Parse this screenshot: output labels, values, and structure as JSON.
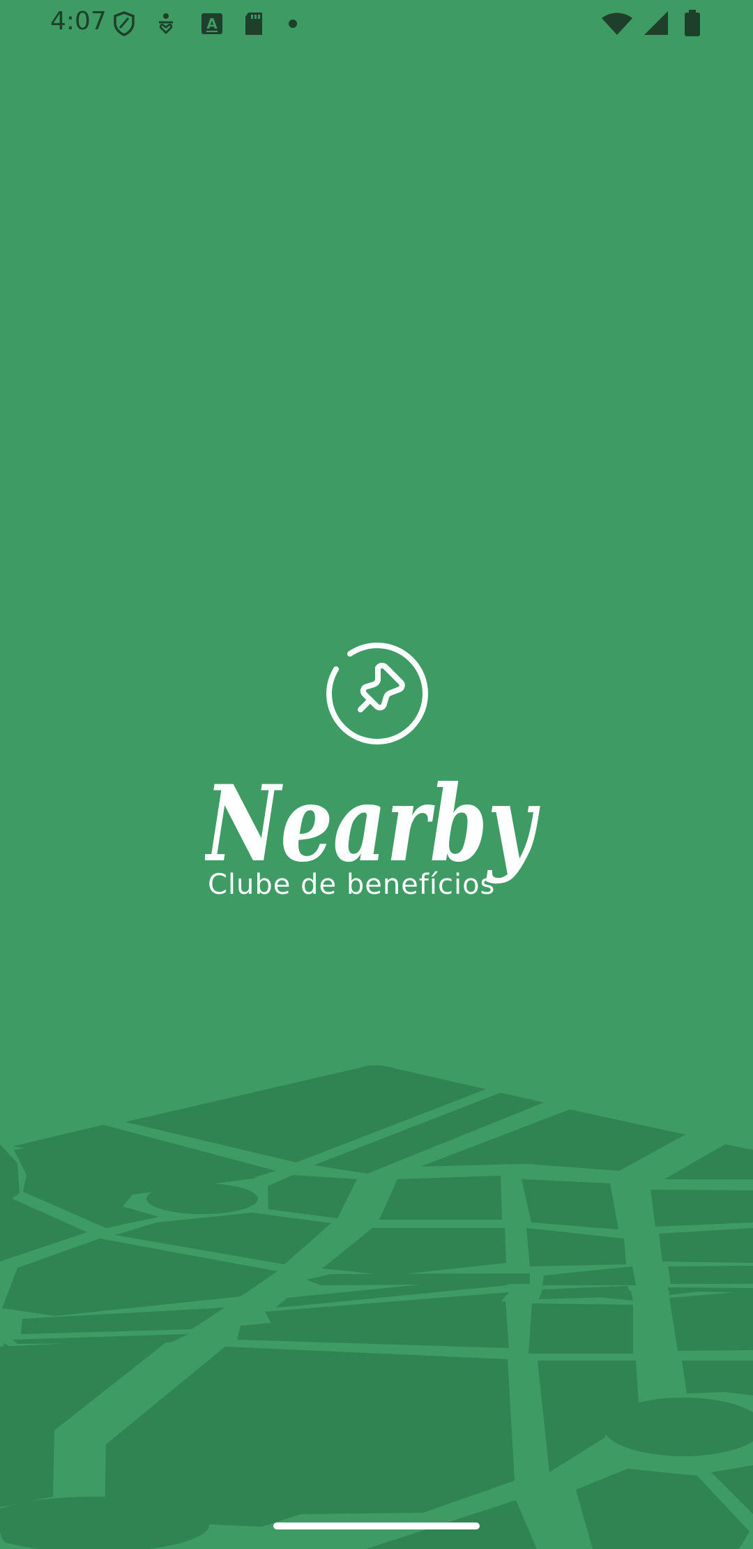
{
  "status_bar": {
    "time": "4:07",
    "left_icons": [
      "shield-icon",
      "accessibility-icon",
      "font-a-icon",
      "sd-card-icon",
      "dot-icon"
    ],
    "right_icons": [
      "wifi-icon",
      "cell-signal-icon",
      "battery-icon"
    ]
  },
  "splash": {
    "app_name": "Nearby",
    "tagline": "Clube de benefícios",
    "logo_icon": "pushpin-circle-icon"
  },
  "colors": {
    "background": "#3D9B63",
    "map_block": "#2F8452",
    "foreground": "#FFFFFF",
    "status_icons": "#1E3F2A"
  }
}
